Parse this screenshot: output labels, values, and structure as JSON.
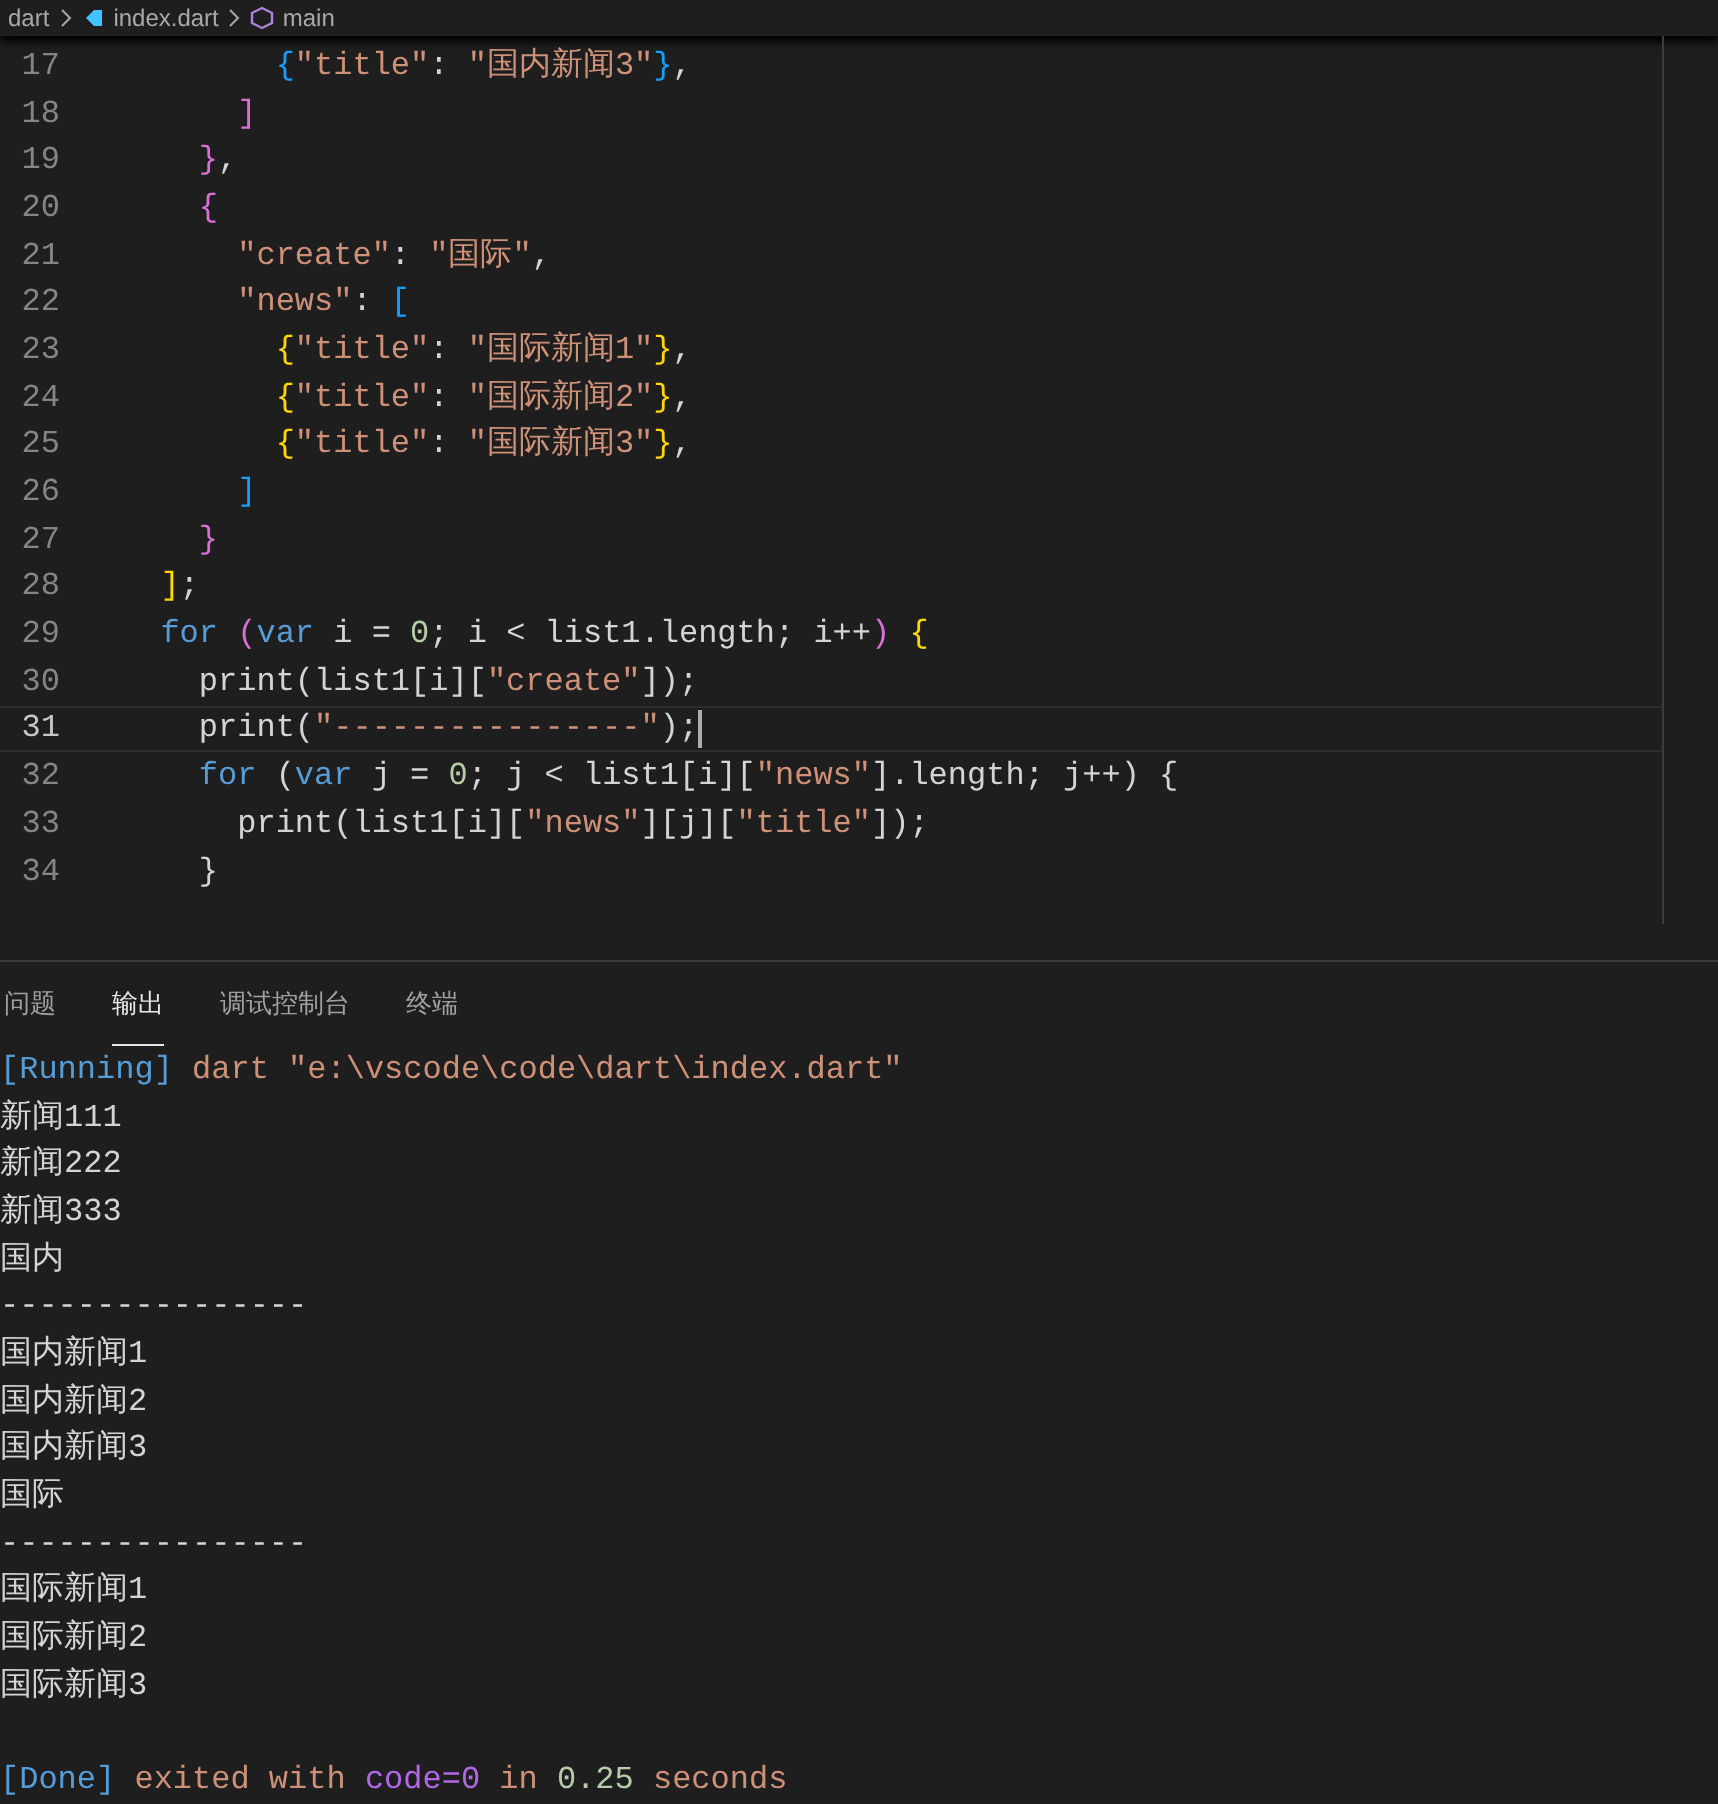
{
  "breadcrumb": [
    {
      "label": "dart",
      "kind": "folder"
    },
    {
      "label": "index.dart",
      "kind": "file"
    },
    {
      "label": "main",
      "kind": "symbol"
    }
  ],
  "editor": {
    "lines": [
      {
        "number": "17",
        "active": false,
        "tokens": [
          {
            "text": "        {",
            "kind": "b3"
          },
          {
            "text": "\"title\"",
            "kind": "str"
          },
          {
            "text": ": ",
            "kind": "plain"
          },
          {
            "text": "\"国内新闻3\"",
            "kind": "str"
          },
          {
            "text": "}",
            "kind": "b3"
          },
          {
            "text": ",",
            "kind": "plain"
          }
        ]
      },
      {
        "number": "18",
        "active": false,
        "tokens": [
          {
            "text": "      ]",
            "kind": "b2"
          }
        ]
      },
      {
        "number": "19",
        "active": false,
        "tokens": [
          {
            "text": "    }",
            "kind": "b2"
          },
          {
            "text": ",",
            "kind": "plain"
          }
        ]
      },
      {
        "number": "20",
        "active": false,
        "tokens": [
          {
            "text": "    {",
            "kind": "b2"
          }
        ]
      },
      {
        "number": "21",
        "active": false,
        "tokens": [
          {
            "text": "      \"create\"",
            "kind": "str"
          },
          {
            "text": ": ",
            "kind": "plain"
          },
          {
            "text": "\"国际\"",
            "kind": "str"
          },
          {
            "text": ",",
            "kind": "plain"
          }
        ]
      },
      {
        "number": "22",
        "active": false,
        "tokens": [
          {
            "text": "      \"news\"",
            "kind": "str"
          },
          {
            "text": ": ",
            "kind": "plain"
          },
          {
            "text": "[",
            "kind": "b3"
          }
        ]
      },
      {
        "number": "23",
        "active": false,
        "tokens": [
          {
            "text": "        {",
            "kind": "b1"
          },
          {
            "text": "\"title\"",
            "kind": "str"
          },
          {
            "text": ": ",
            "kind": "plain"
          },
          {
            "text": "\"国际新闻1\"",
            "kind": "str"
          },
          {
            "text": "}",
            "kind": "b1"
          },
          {
            "text": ",",
            "kind": "plain"
          }
        ]
      },
      {
        "number": "24",
        "active": false,
        "tokens": [
          {
            "text": "        {",
            "kind": "b1"
          },
          {
            "text": "\"title\"",
            "kind": "str"
          },
          {
            "text": ": ",
            "kind": "plain"
          },
          {
            "text": "\"国际新闻2\"",
            "kind": "str"
          },
          {
            "text": "}",
            "kind": "b1"
          },
          {
            "text": ",",
            "kind": "plain"
          }
        ]
      },
      {
        "number": "25",
        "active": false,
        "tokens": [
          {
            "text": "        {",
            "kind": "b1"
          },
          {
            "text": "\"title\"",
            "kind": "str"
          },
          {
            "text": ": ",
            "kind": "plain"
          },
          {
            "text": "\"国际新闻3\"",
            "kind": "str"
          },
          {
            "text": "}",
            "kind": "b1"
          },
          {
            "text": ",",
            "kind": "plain"
          }
        ]
      },
      {
        "number": "26",
        "active": false,
        "tokens": [
          {
            "text": "      ]",
            "kind": "b3"
          }
        ]
      },
      {
        "number": "27",
        "active": false,
        "tokens": [
          {
            "text": "    }",
            "kind": "b2"
          }
        ]
      },
      {
        "number": "28",
        "active": false,
        "tokens": [
          {
            "text": "  ]",
            "kind": "b1"
          },
          {
            "text": ";",
            "kind": "plain"
          }
        ]
      },
      {
        "number": "29",
        "active": false,
        "tokens": [
          {
            "text": "  for",
            "kind": "kw"
          },
          {
            "text": " (",
            "kind": "b2"
          },
          {
            "text": "var",
            "kind": "kw"
          },
          {
            "text": " i = ",
            "kind": "plain"
          },
          {
            "text": "0",
            "kind": "num"
          },
          {
            "text": "; i < list1.length; i++",
            "kind": "plain"
          },
          {
            "text": ")",
            "kind": "b2"
          },
          {
            "text": " {",
            "kind": "b1"
          }
        ]
      },
      {
        "number": "30",
        "active": false,
        "tokens": [
          {
            "text": "    print(list1[i][",
            "kind": "plain"
          },
          {
            "text": "\"create\"",
            "kind": "str"
          },
          {
            "text": "]);",
            "kind": "plain"
          }
        ]
      },
      {
        "number": "31",
        "active": true,
        "tokens": [
          {
            "text": "    print(",
            "kind": "plain"
          },
          {
            "text": "\"----------------\"",
            "kind": "str"
          },
          {
            "text": ");",
            "kind": "plain"
          }
        ]
      },
      {
        "number": "32",
        "active": false,
        "tokens": [
          {
            "text": "    for",
            "kind": "kw"
          },
          {
            "text": " (",
            "kind": "plain"
          },
          {
            "text": "var",
            "kind": "kw"
          },
          {
            "text": " j = ",
            "kind": "plain"
          },
          {
            "text": "0",
            "kind": "num"
          },
          {
            "text": "; j < list1[i][",
            "kind": "plain"
          },
          {
            "text": "\"news\"",
            "kind": "str"
          },
          {
            "text": "].length; j++) {",
            "kind": "plain"
          }
        ]
      },
      {
        "number": "33",
        "active": false,
        "tokens": [
          {
            "text": "      print(list1[i][",
            "kind": "plain"
          },
          {
            "text": "\"news\"",
            "kind": "str"
          },
          {
            "text": "][j][",
            "kind": "plain"
          },
          {
            "text": "\"title\"",
            "kind": "str"
          },
          {
            "text": "]);",
            "kind": "plain"
          }
        ]
      },
      {
        "number": "34",
        "active": false,
        "tokens": [
          {
            "text": "    }",
            "kind": "plain"
          }
        ]
      }
    ]
  },
  "panel": {
    "tabs": [
      {
        "label": "问题",
        "selected": false
      },
      {
        "label": "输出",
        "selected": true
      },
      {
        "label": "调试控制台",
        "selected": false
      },
      {
        "label": "终端",
        "selected": false
      }
    ],
    "output": [
      {
        "kind": "line",
        "tokens": [
          {
            "text": "[Running]",
            "kind": "tag"
          },
          {
            "text": " dart \"e:\\vscode\\code\\dart\\index.dart\"",
            "kind": "str"
          }
        ]
      },
      {
        "kind": "line",
        "tokens": [
          {
            "text": "新闻111",
            "kind": "plain"
          }
        ]
      },
      {
        "kind": "line",
        "tokens": [
          {
            "text": "新闻222",
            "kind": "plain"
          }
        ]
      },
      {
        "kind": "line",
        "tokens": [
          {
            "text": "新闻333",
            "kind": "plain"
          }
        ]
      },
      {
        "kind": "line",
        "tokens": [
          {
            "text": "国内",
            "kind": "plain"
          }
        ]
      },
      {
        "kind": "line",
        "tokens": [
          {
            "text": "----------------",
            "kind": "plain"
          }
        ]
      },
      {
        "kind": "line",
        "tokens": [
          {
            "text": "国内新闻1",
            "kind": "plain"
          }
        ]
      },
      {
        "kind": "line",
        "tokens": [
          {
            "text": "国内新闻2",
            "kind": "plain"
          }
        ]
      },
      {
        "kind": "line",
        "tokens": [
          {
            "text": "国内新闻3",
            "kind": "plain"
          }
        ]
      },
      {
        "kind": "line",
        "tokens": [
          {
            "text": "国际",
            "kind": "plain"
          }
        ]
      },
      {
        "kind": "line",
        "tokens": [
          {
            "text": "----------------",
            "kind": "plain"
          }
        ]
      },
      {
        "kind": "line",
        "tokens": [
          {
            "text": "国际新闻1",
            "kind": "plain"
          }
        ]
      },
      {
        "kind": "line",
        "tokens": [
          {
            "text": "国际新闻2",
            "kind": "plain"
          }
        ]
      },
      {
        "kind": "line",
        "tokens": [
          {
            "text": "国际新闻3",
            "kind": "plain"
          }
        ]
      },
      {
        "kind": "blank"
      },
      {
        "kind": "line",
        "tokens": [
          {
            "text": "[Done]",
            "kind": "tag"
          },
          {
            "text": " exited with ",
            "kind": "str"
          },
          {
            "text": "code=0",
            "kind": "code"
          },
          {
            "text": " in ",
            "kind": "str"
          },
          {
            "text": "0.25",
            "kind": "num"
          },
          {
            "text": " seconds",
            "kind": "str"
          }
        ]
      }
    ]
  }
}
